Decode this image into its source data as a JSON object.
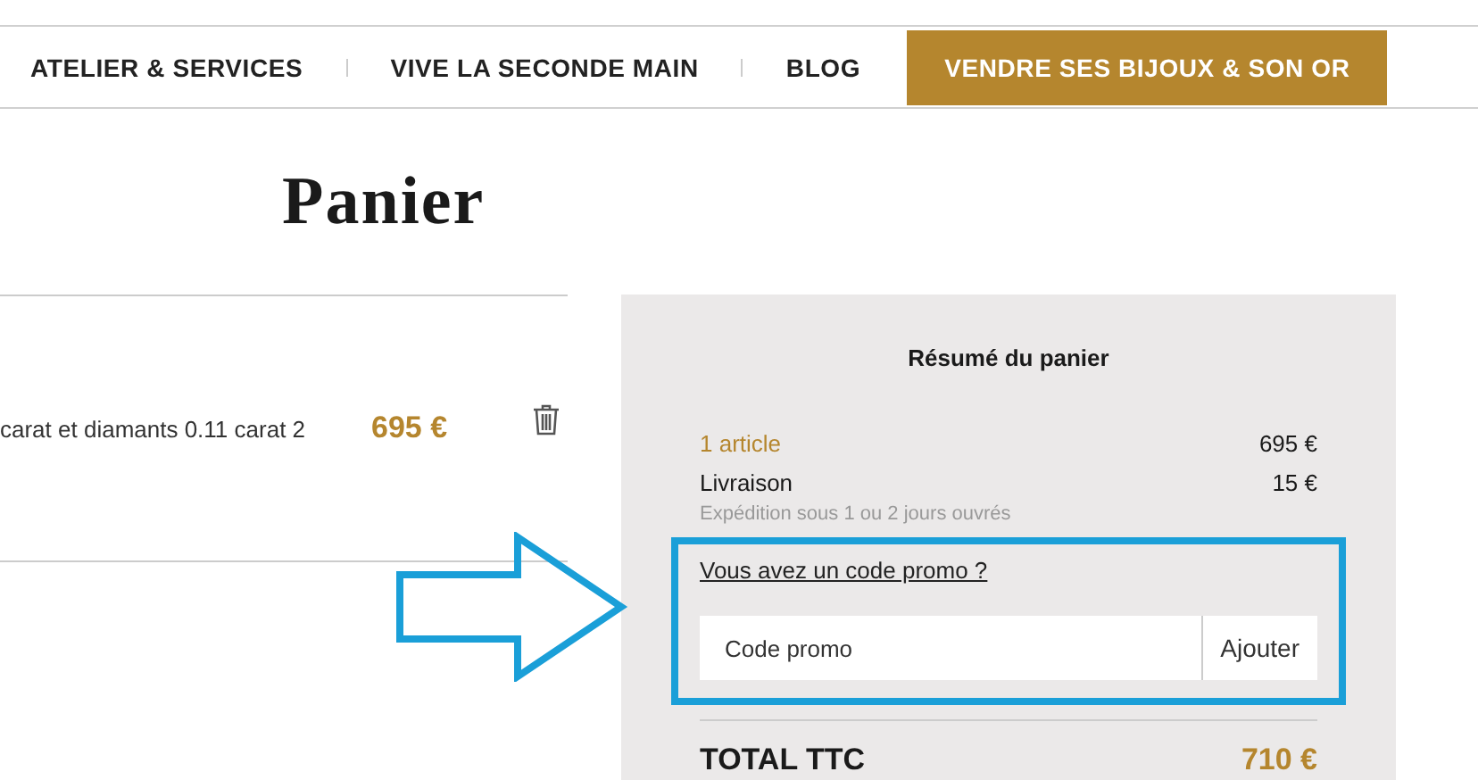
{
  "nav": [
    {
      "label": "ATELIER & SERVICES",
      "kind": "link"
    },
    {
      "label": "VIVE LA SECONDE MAIN",
      "kind": "link"
    },
    {
      "label": "BLOG",
      "kind": "link"
    },
    {
      "label": "VENDRE SES BIJOUX & SON OR",
      "kind": "cta"
    }
  ],
  "title": "Panier",
  "cart_item": {
    "name": "carat et diamants 0.11 carat 2",
    "price": "695 €"
  },
  "summary": {
    "title": "Résumé du panier",
    "lines": [
      {
        "label": "1 article",
        "value": "695 €",
        "kind": "accent"
      },
      {
        "label": "Livraison",
        "value": "15 €",
        "kind": "plain",
        "note": "Expédition sous 1 ou 2 jours ouvrés"
      }
    ],
    "promo": {
      "link": "Vous avez un code promo ?",
      "placeholder": "Code promo",
      "button": "Ajouter"
    },
    "total": {
      "label": "TOTAL TTC",
      "value": "710 €"
    }
  }
}
